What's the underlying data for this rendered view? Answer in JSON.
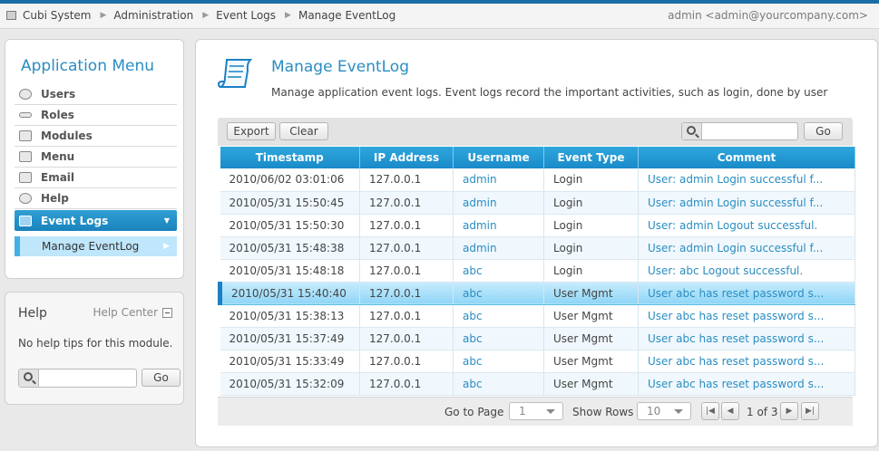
{
  "topbar": {
    "crumbs": [
      "Cubi System",
      "Administration",
      "Event Logs",
      "Manage EventLog"
    ],
    "user": "admin <admin@yourcompany.com>"
  },
  "menu": {
    "title": "Application Menu",
    "items": [
      {
        "label": "Users",
        "icon": "user-icon"
      },
      {
        "label": "Roles",
        "icon": "key-icon"
      },
      {
        "label": "Modules",
        "icon": "modules-icon"
      },
      {
        "label": "Menu",
        "icon": "menu-icon"
      },
      {
        "label": "Email",
        "icon": "email-icon"
      },
      {
        "label": "Help",
        "icon": "help-icon"
      },
      {
        "label": "Event Logs",
        "icon": "event-logs-icon"
      }
    ],
    "submenu": {
      "label": "Manage EventLog"
    }
  },
  "help": {
    "title": "Help",
    "center": "Help Center",
    "text": "No help tips for this module.",
    "go": "Go"
  },
  "main": {
    "title": "Manage EventLog",
    "description": "Manage application event logs. Event logs record the important activities, such as login, done by user",
    "toolbar": {
      "export": "Export",
      "clear": "Clear",
      "go": "Go",
      "search_value": ""
    },
    "columns": [
      "Timestamp",
      "IP Address",
      "Username",
      "Event Type",
      "Comment"
    ],
    "rows": [
      [
        "2010/06/02 03:01:06",
        "127.0.0.1",
        "admin",
        "Login",
        "User: admin Login successful f..."
      ],
      [
        "2010/05/31 15:50:45",
        "127.0.0.1",
        "admin",
        "Login",
        "User: admin Login successful f..."
      ],
      [
        "2010/05/31 15:50:30",
        "127.0.0.1",
        "admin",
        "Login",
        "User: admin Logout successful."
      ],
      [
        "2010/05/31 15:48:38",
        "127.0.0.1",
        "admin",
        "Login",
        "User: admin Login successful f..."
      ],
      [
        "2010/05/31 15:48:18",
        "127.0.0.1",
        "abc",
        "Login",
        "User: abc Logout successful."
      ],
      [
        "2010/05/31 15:40:40",
        "127.0.0.1",
        "abc",
        "User Mgmt",
        "User abc has reset password s..."
      ],
      [
        "2010/05/31 15:38:13",
        "127.0.0.1",
        "abc",
        "User Mgmt",
        "User abc has reset password s..."
      ],
      [
        "2010/05/31 15:37:49",
        "127.0.0.1",
        "abc",
        "User Mgmt",
        "User abc has reset password s..."
      ],
      [
        "2010/05/31 15:33:49",
        "127.0.0.1",
        "abc",
        "User Mgmt",
        "User abc has reset password s..."
      ],
      [
        "2010/05/31 15:32:09",
        "127.0.0.1",
        "abc",
        "User Mgmt",
        "User abc has reset password s..."
      ]
    ],
    "selected_row": 5,
    "pager": {
      "goto_label": "Go to Page",
      "page": "1",
      "rows_label": "Show Rows",
      "rows": "10",
      "page_info": "1 of 3"
    }
  }
}
